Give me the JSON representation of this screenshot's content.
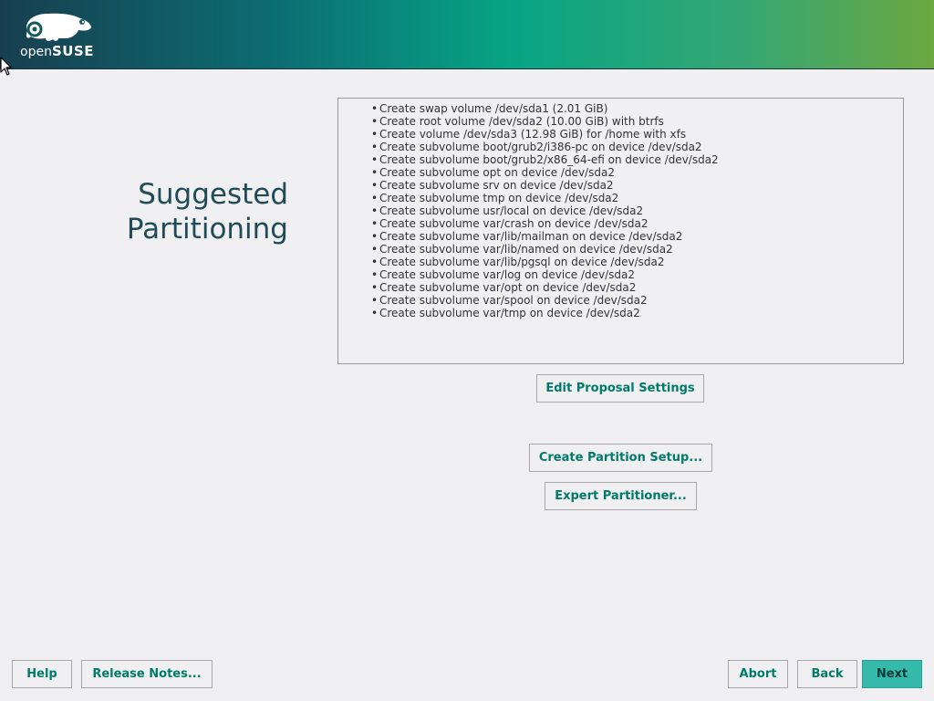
{
  "branding": {
    "logo_text_open": "open",
    "logo_text_suse": "SUSE",
    "banner_colors": [
      "#173f4f",
      "#07a585",
      "#6ca740"
    ]
  },
  "page": {
    "title_line1": "Suggested",
    "title_line2": "Partitioning"
  },
  "proposal": {
    "items": [
      "Create swap volume /dev/sda1 (2.01 GiB)",
      "Create root volume /dev/sda2 (10.00 GiB) with btrfs",
      "Create volume /dev/sda3 (12.98 GiB) for /home with xfs",
      "Create subvolume boot/grub2/i386-pc on device /dev/sda2",
      "Create subvolume boot/grub2/x86_64-efi on device /dev/sda2",
      "Create subvolume opt on device /dev/sda2",
      "Create subvolume srv on device /dev/sda2",
      "Create subvolume tmp on device /dev/sda2",
      "Create subvolume usr/local on device /dev/sda2",
      "Create subvolume var/crash on device /dev/sda2",
      "Create subvolume var/lib/mailman on device /dev/sda2",
      "Create subvolume var/lib/named on device /dev/sda2",
      "Create subvolume var/lib/pgsql on device /dev/sda2",
      "Create subvolume var/log on device /dev/sda2",
      "Create subvolume var/opt on device /dev/sda2",
      "Create subvolume var/spool on device /dev/sda2",
      "Create subvolume var/tmp on device /dev/sda2"
    ]
  },
  "actions": {
    "edit_proposal": "Edit Proposal Settings",
    "create_setup": "Create Partition Setup...",
    "expert": "Expert Partitioner..."
  },
  "footer": {
    "help": "Help",
    "release_notes": "Release Notes...",
    "abort": "Abort",
    "back": "Back",
    "next": "Next"
  },
  "colors": {
    "accent": "#007a6a",
    "primary_button": "#35b9ab",
    "title": "#1f4b57"
  }
}
